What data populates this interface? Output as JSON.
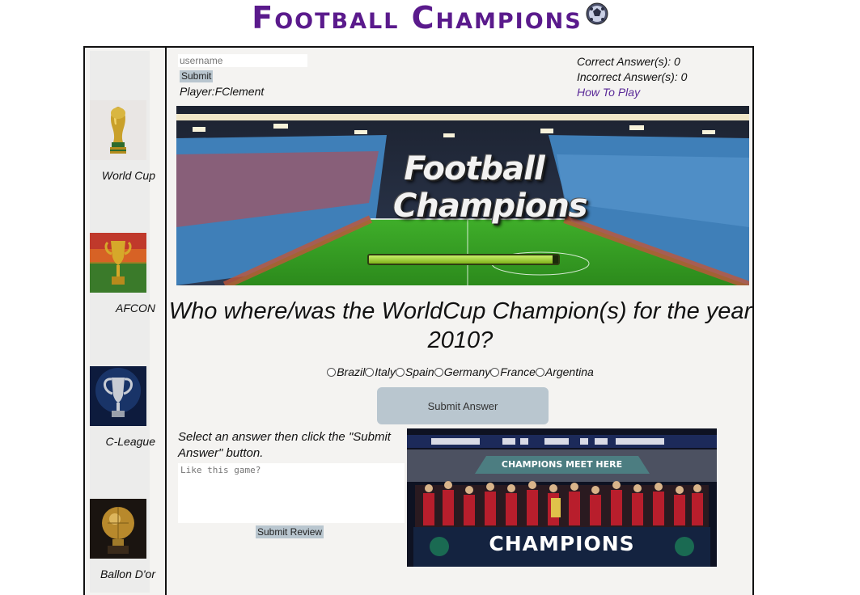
{
  "header": {
    "title": "Football Champions",
    "ball_icon": "soccer-ball-icon"
  },
  "sidebar": {
    "items": [
      {
        "label": "World Cup",
        "icon": "world-cup-trophy-image"
      },
      {
        "label": "AFCON",
        "icon": "afcon-trophy-image"
      },
      {
        "label": "C-League",
        "icon": "champions-league-trophy-image"
      },
      {
        "label": "Ballon D'or",
        "icon": "ballon-dor-trophy-image"
      }
    ]
  },
  "login": {
    "username_placeholder": "username",
    "submit_label": "Submit",
    "player_text": "Player:FClement"
  },
  "stats": {
    "correct_text": "Correct Answer(s): 0",
    "incorrect_text": "Incorrect Answer(s): 0",
    "how_to_play": "How To Play"
  },
  "banner": {
    "title_line1": "Football",
    "title_line2": "Champions",
    "progress": 0.97
  },
  "quiz": {
    "question": "Who where/was the WorldCup Champion(s) for the year 2010?",
    "options": [
      "Brazil",
      "Italy",
      "Spain",
      "Germany",
      "France",
      "Argentina"
    ],
    "submit_label": "Submit Answer"
  },
  "review": {
    "instructions": "Select an answer then click the \"Submit Answer\" button.",
    "placeholder": "Like this game?",
    "submit_label": "Submit Review"
  },
  "photo": {
    "banner_text": "CHAMPIONS MEET HERE",
    "board_text": "CHAMPIONS"
  },
  "colors": {
    "title_purple": "#5a1a8c",
    "link_purple": "#5a2a98",
    "button_blue_grey": "#b9c6cf",
    "panel_bg": "#f4f3f1"
  }
}
